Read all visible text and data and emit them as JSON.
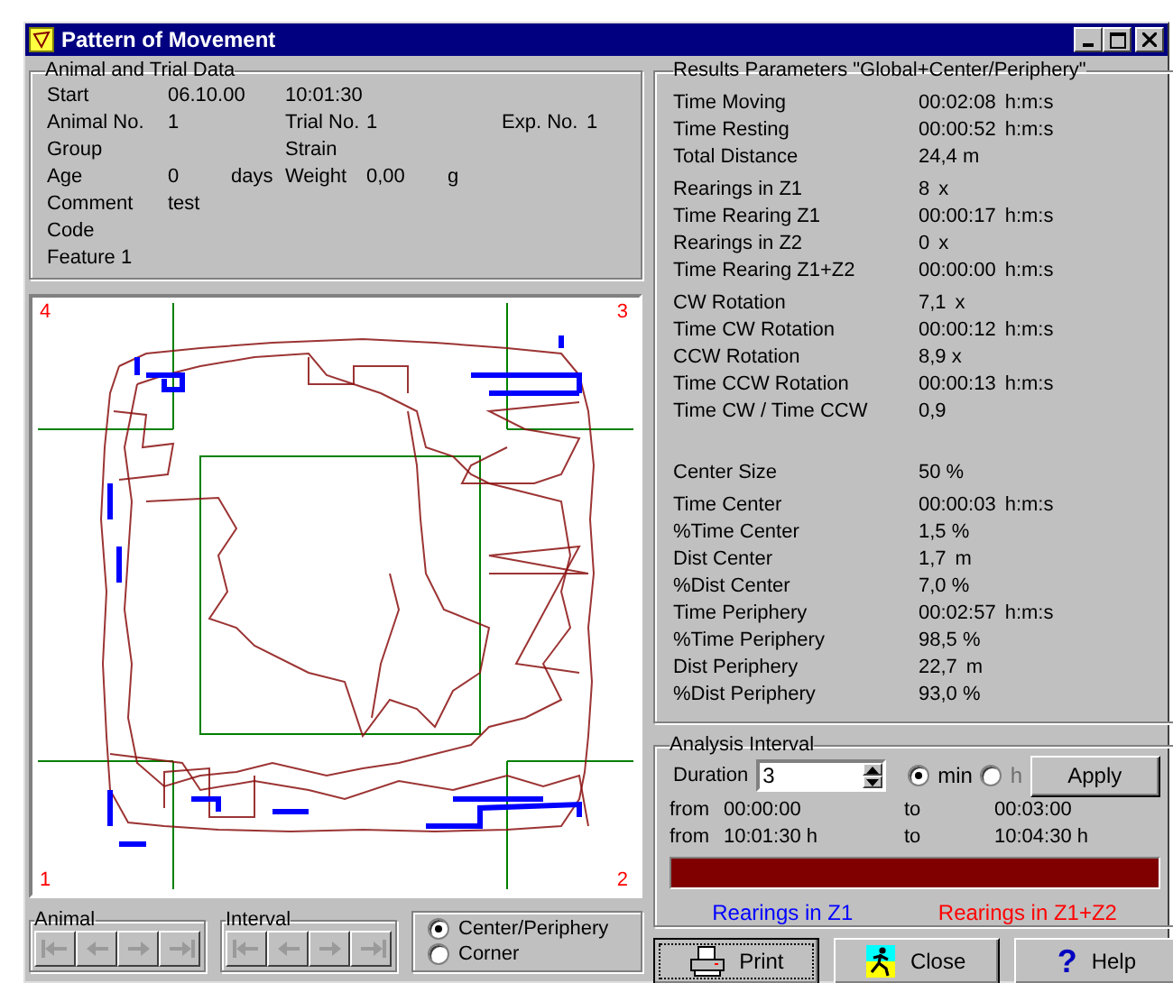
{
  "window": {
    "title": "Pattern of Movement"
  },
  "trial_data": {
    "title": "Animal and Trial Data",
    "rows": [
      {
        "label": "Start",
        "value": "06.10.00",
        "label_2": "10:01:30"
      },
      {
        "label": "Animal No.",
        "value": "1",
        "label_2": "Trial No.",
        "value_2": "1",
        "label_3": "Exp. No.",
        "value_3": "1"
      },
      {
        "label": "Group",
        "label_2": "Strain"
      },
      {
        "label": "Age",
        "value": "0",
        "unit": "days",
        "label_2": "Weight",
        "value_2": "0,00",
        "unit_2": "g"
      },
      {
        "label": "Comment",
        "value": "test"
      },
      {
        "label": "Code"
      },
      {
        "label": "Feature 1"
      }
    ]
  },
  "track_plot": {
    "corner_labels": [
      "4",
      "3",
      "1",
      "2"
    ]
  },
  "animal_nav": {
    "title": "Animal",
    "buttons": [
      {
        "kind": "first",
        "disabled": true
      },
      {
        "kind": "prev",
        "disabled": true
      },
      {
        "kind": "next",
        "disabled": true
      },
      {
        "kind": "last",
        "disabled": true
      }
    ]
  },
  "interval_nav": {
    "title": "Interval",
    "buttons": [
      {
        "kind": "first",
        "disabled": true
      },
      {
        "kind": "prev",
        "disabled": true
      },
      {
        "kind": "next",
        "disabled": true
      },
      {
        "kind": "last",
        "disabled": true
      }
    ]
  },
  "zone_mode": [
    {
      "label": "Center/Periphery",
      "selected": true
    },
    {
      "label": "Corner",
      "selected": false
    }
  ],
  "results": {
    "title": "Results Parameters \"Global+Center/Periphery\"",
    "groups": [
      [
        {
          "label": "Time Moving",
          "value": "00:02:08",
          "unit": "h:m:s"
        },
        {
          "label": "Time Resting",
          "value": "00:00:52",
          "unit": "h:m:s"
        },
        {
          "label": "Total Distance",
          "value": "24,4 m"
        }
      ],
      [
        {
          "label": "Rearings in Z1",
          "value": "8",
          "unit": "x"
        },
        {
          "label": "Time Rearing Z1",
          "value": "00:00:17",
          "unit": "h:m:s"
        },
        {
          "label": "Rearings in Z2",
          "value": "0",
          "unit": "x"
        },
        {
          "label": "Time Rearing Z1+Z2",
          "value": "00:00:00",
          "unit": "h:m:s"
        }
      ],
      [
        {
          "label": "CW Rotation",
          "value": "7,1",
          "unit": "x"
        },
        {
          "label": "Time CW Rotation",
          "value": "00:00:12",
          "unit": "h:m:s"
        },
        {
          "label": "CCW Rotation",
          "value": "8,9 x"
        },
        {
          "label": "Time CCW Rotation",
          "value": "00:00:13",
          "unit": "h:m:s"
        },
        {
          "label": "Time CW / Time CCW",
          "value": "0,9"
        }
      ],
      [
        {
          "label": "Center Size",
          "value": "50 %"
        }
      ],
      [
        {
          "label": "Time Center",
          "value": "00:00:03",
          "unit": "h:m:s"
        },
        {
          "label": "%Time Center",
          "value": "1,5 %"
        },
        {
          "label": "Dist Center",
          "value": "1,7",
          "unit": "m"
        },
        {
          "label": "%Dist Center",
          "value": "7,0 %"
        },
        {
          "label": "Time Periphery",
          "value": "00:02:57",
          "unit": "h:m:s"
        },
        {
          "label": "%Time Periphery",
          "value": "98,5 %"
        },
        {
          "label": "Dist Periphery",
          "value": "22,7",
          "unit": "m"
        },
        {
          "label": "%Dist Periphery",
          "value": "93,0 %"
        }
      ]
    ]
  },
  "analysis": {
    "title": "Analysis Interval",
    "duration_label": "Duration",
    "duration": "3",
    "units": [
      {
        "label": "min",
        "selected": true,
        "disabled": false
      },
      {
        "label": "h",
        "selected": false,
        "disabled": true
      }
    ],
    "apply": "Apply",
    "ranges": [
      {
        "from_label": "from",
        "from": "00:00:00",
        "to_label": "to",
        "to": "00:03:00"
      },
      {
        "from_label": "from",
        "from": "10:01:30 h",
        "to_label": "to",
        "to": "10:04:30 h"
      }
    ],
    "bar": {
      "level": 1
    },
    "legend": [
      {
        "label": "Rearings in Z1",
        "color": "#0000ff"
      },
      {
        "label": "Rearings in Z1+Z2",
        "color": "#ff0000"
      }
    ]
  },
  "buttons": [
    {
      "kind": "print",
      "label": "Print",
      "focused": true
    },
    {
      "kind": "close",
      "label": "Close",
      "focused": false
    },
    {
      "kind": "help",
      "label": "Help",
      "icon": "?",
      "focused": false
    }
  ]
}
